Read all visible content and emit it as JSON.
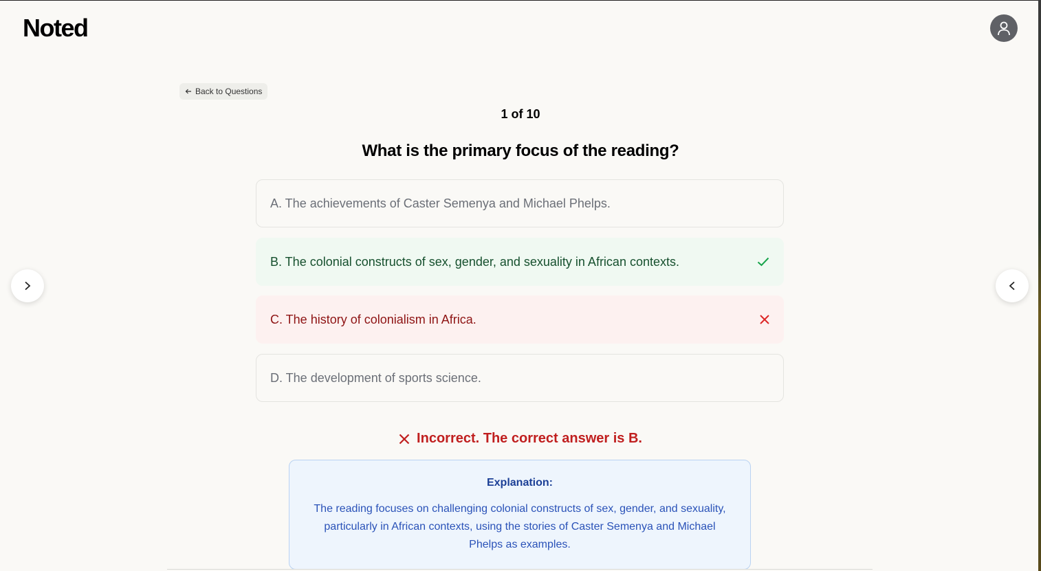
{
  "app": {
    "logo": "Noted"
  },
  "nav": {
    "back_label": "Back to Questions"
  },
  "quiz": {
    "counter": "1 of 10",
    "question": "What is the primary focus of the reading?",
    "options": [
      {
        "label": "A. The achievements of Caster Semenya and Michael Phelps.",
        "state": "neutral"
      },
      {
        "label": "B. The colonial constructs of sex, gender, and sexuality in African contexts.",
        "state": "correct"
      },
      {
        "label": "C. The history of colonialism in Africa.",
        "state": "incorrect"
      },
      {
        "label": "D. The development of sports science.",
        "state": "neutral"
      }
    ],
    "result": "Incorrect. The correct answer is B.",
    "explanation": {
      "title": "Explanation:",
      "body": "The reading focuses on challenging colonial constructs of sex, gender, and sexuality, particularly in African contexts, using the stories of Caster Semenya and Michael Phelps as examples."
    }
  },
  "colors": {
    "correct": "#16a34a",
    "incorrect": "#dc2626",
    "explanation_bg": "#eef5fd",
    "explanation_text": "#1e45a8"
  },
  "icons": {
    "avatar": "user-icon",
    "back": "arrow-left-icon",
    "correct": "check-icon",
    "incorrect": "x-icon",
    "next": "chevron-right-icon",
    "prev": "chevron-left-icon"
  }
}
